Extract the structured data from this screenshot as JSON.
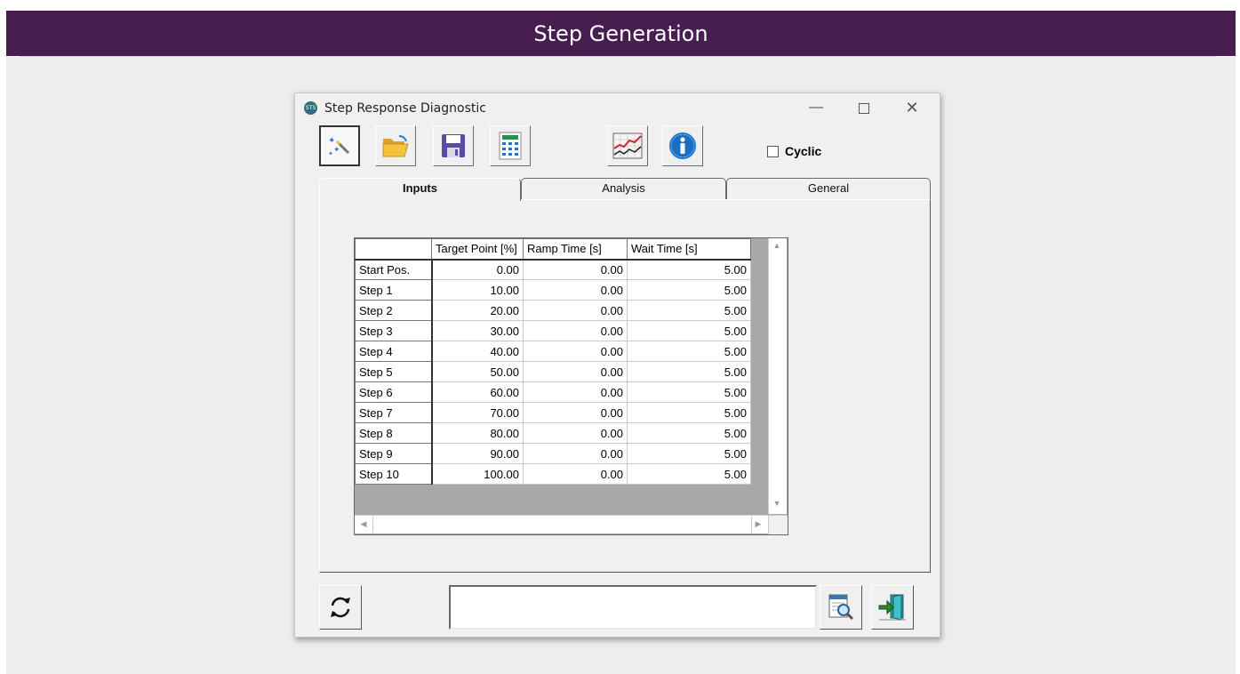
{
  "banner": {
    "title": "Step Generation"
  },
  "window": {
    "title": "Step Response Diagnostic",
    "app_icon_text": "STS",
    "controls": {
      "minimize": "—",
      "maximize": "",
      "close": "✕"
    }
  },
  "toolbar": {
    "buttons": [
      {
        "name": "wizard-button",
        "icon": "magic-wand-icon"
      },
      {
        "name": "open-button",
        "icon": "folder-open-icon"
      },
      {
        "name": "save-button",
        "icon": "floppy-disk-icon"
      },
      {
        "name": "calculator-button",
        "icon": "calculator-icon"
      },
      {
        "name": "chart-button",
        "icon": "line-chart-icon"
      },
      {
        "name": "info-button",
        "icon": "info-icon"
      }
    ],
    "cyclic": {
      "label": "Cyclic",
      "checked": false
    }
  },
  "tabs": [
    {
      "label": "Inputs",
      "active": true
    },
    {
      "label": "Analysis",
      "active": false
    },
    {
      "label": "General",
      "active": false
    }
  ],
  "grid": {
    "columns": [
      "",
      "Target Point [%]",
      "Ramp Time [s]",
      "Wait Time [s]"
    ],
    "rows": [
      {
        "label": "Start Pos.",
        "target": "0.00",
        "ramp": "0.00",
        "wait": "5.00"
      },
      {
        "label": "Step 1",
        "target": "10.00",
        "ramp": "0.00",
        "wait": "5.00"
      },
      {
        "label": "Step 2",
        "target": "20.00",
        "ramp": "0.00",
        "wait": "5.00"
      },
      {
        "label": "Step 3",
        "target": "30.00",
        "ramp": "0.00",
        "wait": "5.00"
      },
      {
        "label": "Step 4",
        "target": "40.00",
        "ramp": "0.00",
        "wait": "5.00"
      },
      {
        "label": "Step 5",
        "target": "50.00",
        "ramp": "0.00",
        "wait": "5.00"
      },
      {
        "label": "Step 6",
        "target": "60.00",
        "ramp": "0.00",
        "wait": "5.00"
      },
      {
        "label": "Step 7",
        "target": "70.00",
        "ramp": "0.00",
        "wait": "5.00"
      },
      {
        "label": "Step 8",
        "target": "80.00",
        "ramp": "0.00",
        "wait": "5.00"
      },
      {
        "label": "Step 9",
        "target": "90.00",
        "ramp": "0.00",
        "wait": "5.00"
      },
      {
        "label": "Step 10",
        "target": "100.00",
        "ramp": "0.00",
        "wait": "5.00"
      }
    ]
  },
  "bottom": {
    "refresh_icon": "refresh-icon",
    "status_text": "",
    "preview_icon": "magnifier-document-icon",
    "exit_icon": "exit-door-icon"
  },
  "colors": {
    "banner": "#481e50",
    "stage": "#ededed",
    "window": "#f0f0f0",
    "accent_blue": "#1a6fc4"
  }
}
